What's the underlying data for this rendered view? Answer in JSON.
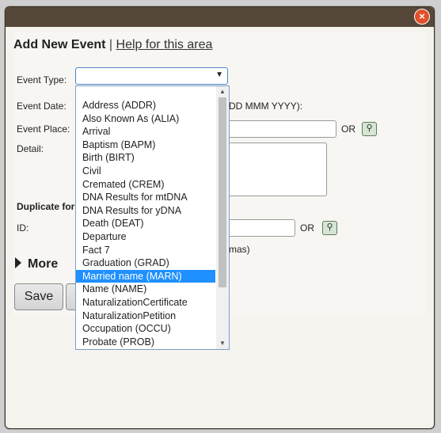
{
  "dialog": {
    "title": "Add New Event",
    "separator": "|",
    "help_link": "Help for this area",
    "close_label": "×"
  },
  "form": {
    "event_type_label": "Event Type:",
    "event_date_label": "Event Date:",
    "date_hint": "DD MMM YYYY):",
    "event_place_label": "Event Place:",
    "or_label": "OR",
    "detail_label": "Detail:",
    "duplicate_label": "Duplicate for",
    "id_label": "ID:",
    "id_or_label": "OR",
    "id_hint": "mas)",
    "more_label": "More",
    "save_label": "Save"
  },
  "dropdown": {
    "selected_value": "",
    "options": [
      "Address (ADDR)",
      "Also Known As (ALIA)",
      "Arrival",
      "Baptism (BAPM)",
      "Birth (BIRT)",
      "Civil",
      "Cremated (CREM)",
      "DNA Results for mtDNA",
      "DNA Results for yDNA",
      "Death (DEAT)",
      "Departure",
      "Fact 7",
      "Graduation (GRAD)",
      "Married name (MARN)",
      "Name (NAME)",
      "NaturalizationCertificate",
      "NaturalizationPetition",
      "Occupation (OCCU)",
      "Probate (PROB)"
    ],
    "highlighted": "Married name (MARN)"
  },
  "colors": {
    "titlebar": "#55473a",
    "close": "#e0502a",
    "highlight": "#1e90ff"
  }
}
